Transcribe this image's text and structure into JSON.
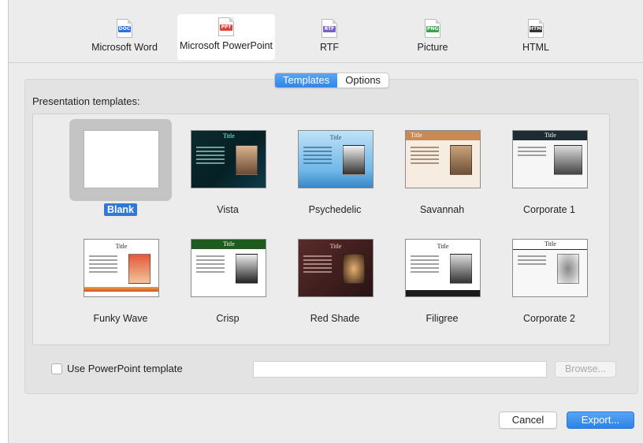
{
  "formats": [
    {
      "tag": "DOC",
      "name": "Microsoft Word",
      "color": "#2f6fd8"
    },
    {
      "tag": "PPT",
      "name": "Microsoft PowerPoint",
      "color": "#e2412e",
      "selected": true
    },
    {
      "tag": "RTF",
      "name": "RTF",
      "color": "#7b5fc9"
    },
    {
      "tag": "PNG",
      "name": "Picture",
      "color": "#3ca24a"
    },
    {
      "tag": "HTML",
      "name": "HTML",
      "color": "#333333"
    }
  ],
  "tabs": {
    "templates": "Templates",
    "options": "Options",
    "active": "templates"
  },
  "section_label": "Presentation templates:",
  "templates": [
    {
      "name": "Blank",
      "selected": true,
      "thumb_title": ""
    },
    {
      "name": "Vista",
      "thumb_title": "Title"
    },
    {
      "name": "Psychedelic",
      "thumb_title": "Title"
    },
    {
      "name": "Savannah",
      "thumb_title": "Title"
    },
    {
      "name": "Corporate 1",
      "thumb_title": "Title"
    },
    {
      "name": "Funky Wave",
      "thumb_title": "Title"
    },
    {
      "name": "Crisp",
      "thumb_title": "Title"
    },
    {
      "name": "Red Shade",
      "thumb_title": "Title"
    },
    {
      "name": "Filigree",
      "thumb_title": "Title"
    },
    {
      "name": "Corporate 2",
      "thumb_title": "Title"
    }
  ],
  "use_template": {
    "label": "Use PowerPoint template",
    "checked": false,
    "path_value": "",
    "browse_label": "Browse..."
  },
  "buttons": {
    "cancel": "Cancel",
    "export": "Export..."
  },
  "colors": {
    "accent": "#2f86e8",
    "selection": "#2f78d8"
  }
}
